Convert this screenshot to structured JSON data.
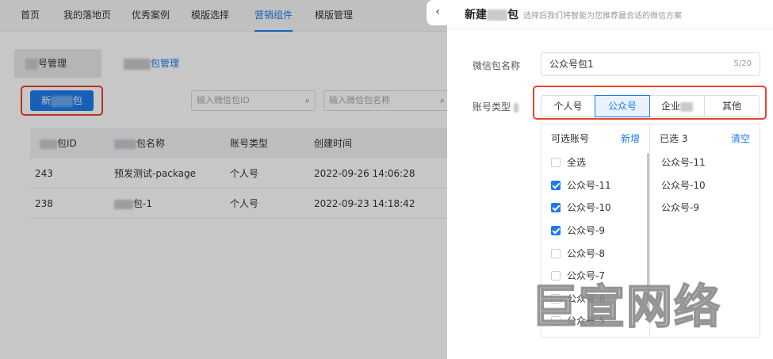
{
  "topnav": {
    "items": [
      "首页",
      "我的落地页",
      "优秀案例",
      "模版选择",
      "营销组件",
      "模版管理"
    ],
    "active_index": 4
  },
  "subtabs": {
    "tab1_label": "号管理",
    "tab2_label": "包管理"
  },
  "toolbar": {
    "new_button_label_a": "新",
    "new_button_label_b": "包",
    "search_id_placeholder": "输入微信包ID",
    "search_name_placeholder": "输入微信包名称"
  },
  "table": {
    "headers": [
      "包ID",
      "包名称",
      "账号类型",
      "创建时间"
    ],
    "rows": [
      [
        "243",
        "预发测试-package",
        "个人号",
        "2022-09-26 14:06:28"
      ],
      [
        "238",
        "包-1",
        "个人号",
        "2022-09-23 14:18:42"
      ]
    ]
  },
  "drawer": {
    "back_icon": "chevron-left-icon",
    "title_a": "新建",
    "title_b": "包",
    "subtitle": "选择后我们将智能为您推荐最合适的微信方案",
    "name_label": "微信包名称",
    "name_value": "公众号包1",
    "name_count": "5/20",
    "type_label": "账号类型",
    "type_options": [
      "个人号",
      "公众号",
      "企业",
      "其他"
    ],
    "type_active_index": 1,
    "available_title": "可选账号",
    "available_action": "新增",
    "selected_title": "已选 3",
    "selected_action": "清空",
    "available": [
      {
        "label": "全选",
        "checked": false
      },
      {
        "label": "公众号-11",
        "checked": true
      },
      {
        "label": "公众号-10",
        "checked": true
      },
      {
        "label": "公众号-9",
        "checked": true
      },
      {
        "label": "公众号-8",
        "checked": false
      },
      {
        "label": "公众号-7",
        "checked": false
      },
      {
        "label": "公众号-6",
        "checked": false
      },
      {
        "label": "公众号-5",
        "checked": false
      }
    ],
    "selected": [
      "公众号-11",
      "公众号-10",
      "公众号-9"
    ]
  },
  "watermark": "巨宣网络",
  "colors": {
    "primary": "#1e7ce8",
    "highlight_box": "#e8432e"
  }
}
